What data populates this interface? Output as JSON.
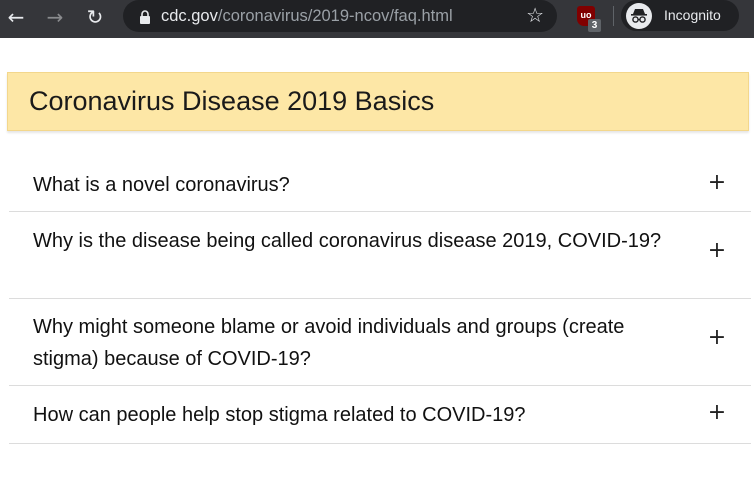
{
  "browser": {
    "back_icon": "←",
    "forward_icon": "→",
    "reload_icon": "↻",
    "url_host": "cdc.gov",
    "url_path": "/coronavirus/2019-ncov/faq.html",
    "star_icon": "☆",
    "extension_label": "uo",
    "extension_badge": "3",
    "incognito_label": "Incognito"
  },
  "page": {
    "section_title": "Coronavirus Disease 2019 Basics",
    "toggle_icon": "+",
    "faq": [
      {
        "question": "What is a novel coronavirus?"
      },
      {
        "question": "Why is the disease being called coronavirus disease 2019, COVID-19?"
      },
      {
        "question": "Why might someone blame or avoid individuals and groups (create stigma) because of COVID-19?"
      },
      {
        "question": "How can people help stop stigma related to COVID-19?"
      }
    ]
  },
  "colors": {
    "toolbar": "#35363a",
    "omnibox": "#202124",
    "banner": "#fde7a6"
  }
}
